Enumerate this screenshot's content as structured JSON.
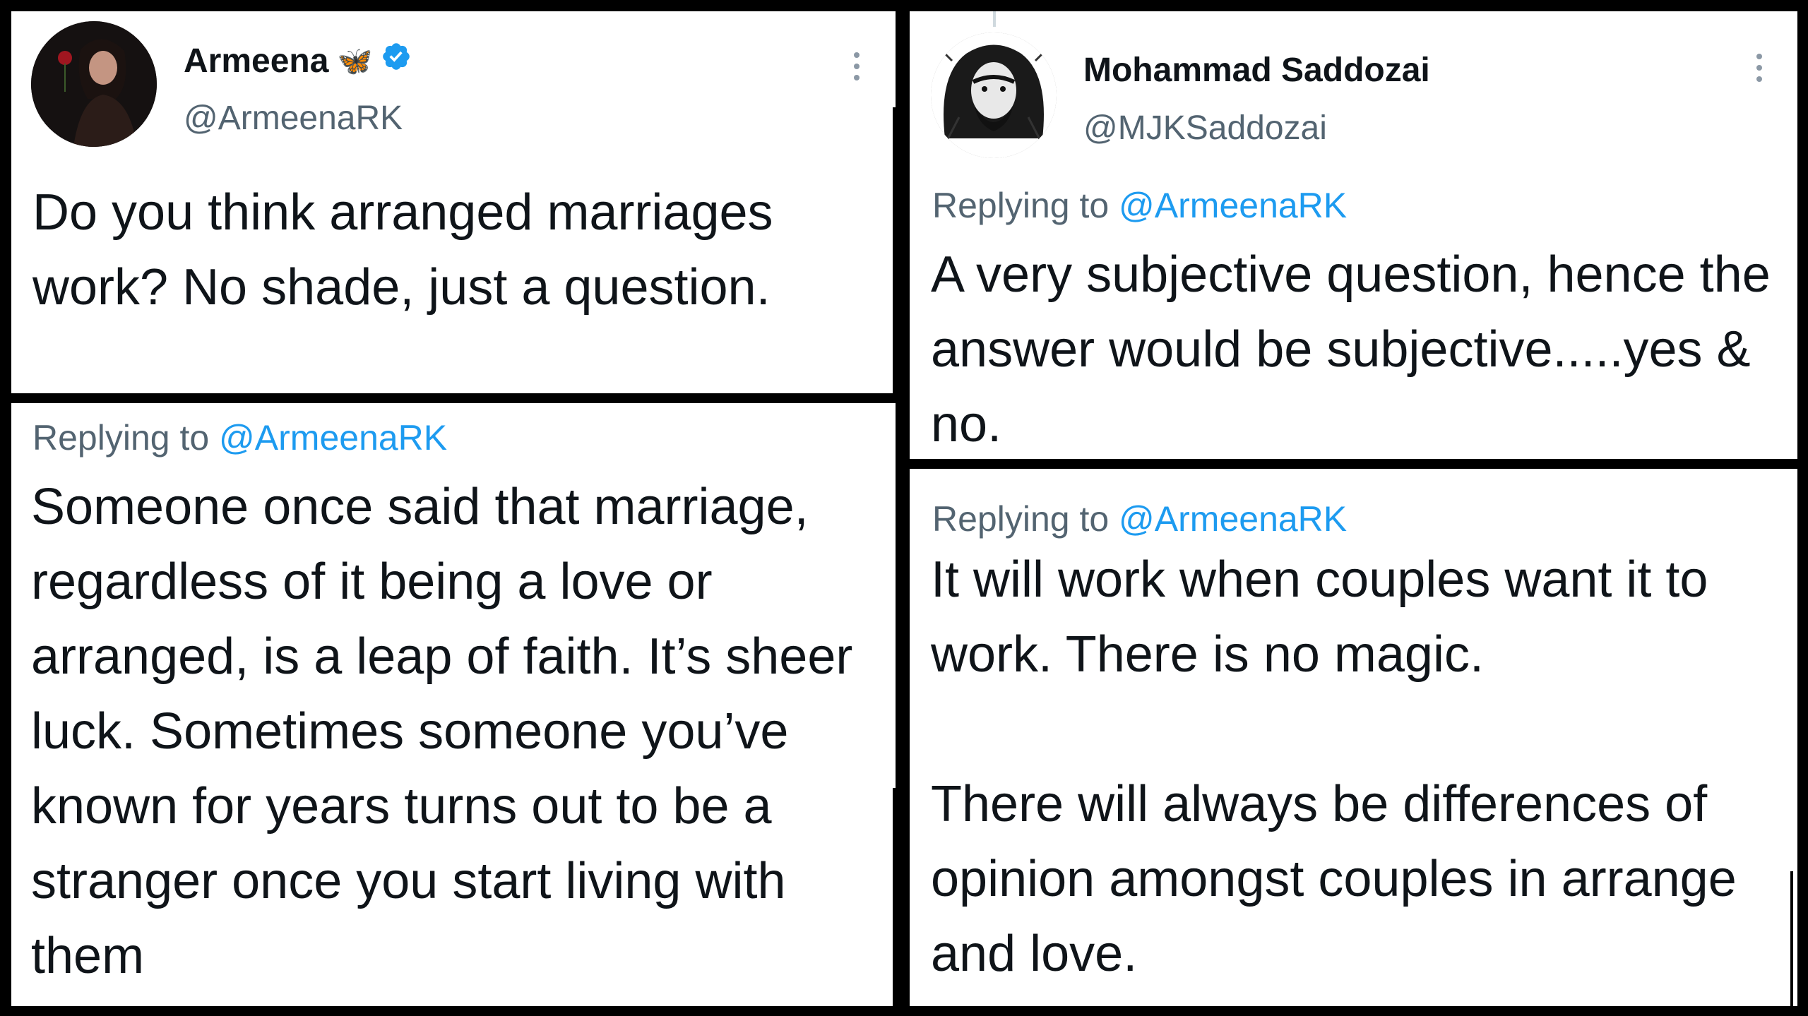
{
  "tweets": {
    "original": {
      "display_name": "Armeena",
      "emoji": "🦋",
      "handle": "@ArmeenaRK",
      "text": "Do you think arranged marriages work? No shade, just a question."
    },
    "reply_left": {
      "replying_prefix": "Replying to ",
      "replying_to": "@ArmeenaRK",
      "text": "Someone once said that marriage, regardless of it being a love or arranged, is a leap of faith. It’s sheer luck. Sometimes someone you’ve known for years turns out to be a stranger once you start living with them"
    },
    "reply_top_right": {
      "display_name": "Mohammad Saddozai",
      "handle": "@MJKSaddozai",
      "replying_prefix": "Replying to ",
      "replying_to": "@ArmeenaRK",
      "text": "A very subjective question, hence the answer would be subjective.....yes & no."
    },
    "reply_bottom_right": {
      "replying_prefix": "Replying to ",
      "replying_to": "@ArmeenaRK",
      "text": "It will work when couples want it to work. There is no magic.\n\nThere will always be differences of opinion amongst couples in arrange and love."
    }
  },
  "colors": {
    "text": "#0f1419",
    "muted": "#536471",
    "link": "#1d9bf0",
    "verified": "#1d9bf0",
    "border": "#000000"
  },
  "icons": {
    "verified": "verified-badge-icon",
    "more": "more-vertical-icon",
    "emoji": "butterfly-emoji"
  }
}
